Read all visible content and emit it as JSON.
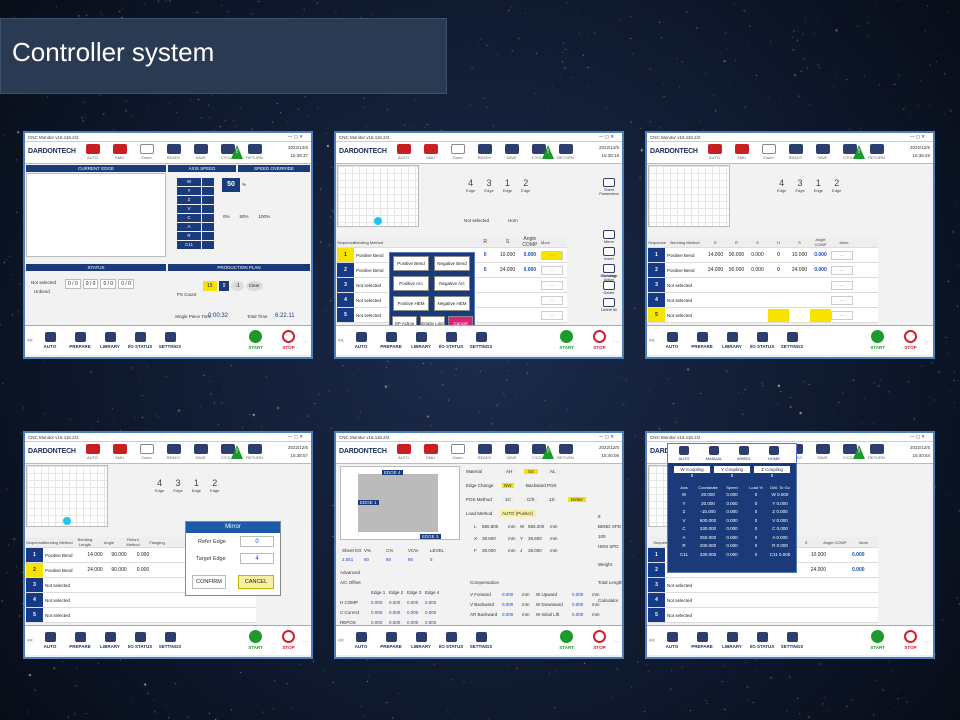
{
  "page": {
    "title": "Controller system"
  },
  "common": {
    "app_title": "CNC Monitor v16.116.2/2",
    "logo": "DARDONTECH",
    "toolbar": [
      "AUTO",
      "SMU",
      "Zoom",
      "READY",
      "SAVE",
      "CYCLE",
      "RETURN"
    ],
    "date": "2022/12/5",
    "bottom": [
      "AUTO",
      "PREPARE",
      "LIBRARY",
      "I/O STATUS",
      "SETTINGS"
    ],
    "start": "START",
    "stop": "STOP",
    "prev": "<<",
    "more": "...",
    "colors": {
      "navy": "#1a3a7a",
      "accent": "#23c5e6",
      "yellow": "#f6e300",
      "green": "#1d9a2c",
      "red": "#d02030"
    }
  },
  "screens": [
    {
      "time": "15:38:37",
      "current_edge": "CURRENT EDGE",
      "axis_speed": "AXIS SPEED",
      "speed_override": "SPEED OVERRIDE",
      "axes": [
        "W",
        "Y",
        "Z",
        "V",
        "C",
        "A",
        "R",
        "C11"
      ],
      "override_value": "50",
      "override_unit": "%",
      "pct_labels": [
        "0%",
        "50%",
        "100%"
      ],
      "status": "STATUS",
      "production_plan": "PRODUCTION PLAN",
      "not_selected": "Not selected",
      "unbend": "Unbend",
      "counters": [
        "0 / 0",
        "0 / 0",
        "0 / 0",
        "0 / 0"
      ],
      "ps_count": "PS Count",
      "plan_values": [
        "15",
        "9",
        "-1",
        "Clear"
      ],
      "single_piece_time_label": "Single Piece Time",
      "single_piece_time": "0:00:32",
      "total_time_label": "Total Time",
      "total_time": "6:22.11"
    },
    {
      "time": "15:38:18",
      "edges": [
        "4",
        "3",
        "1",
        "2"
      ],
      "edge_label": "Edge",
      "not_selected": "Not selected",
      "horn": "Horn",
      "sheet_params": "Sheet Parameters",
      "columns": [
        "Sequence",
        "Bending Method",
        "R",
        "S",
        "Angle COMP",
        "More"
      ],
      "rows": [
        {
          "n": "1",
          "m": "Positive Bend",
          "r": "0",
          "s": "10.000",
          "a": "0.000"
        },
        {
          "n": "2",
          "m": "Positive Bend",
          "r": "0",
          "s": "24.000",
          "a": "0.000"
        },
        {
          "n": "3",
          "m": "Not selected"
        },
        {
          "n": "4",
          "m": "Not selected"
        },
        {
          "n": "5",
          "m": "Not selected"
        }
      ],
      "menu": [
        "Positive Bend",
        "Negative Bend",
        "Positive Arc",
        "Negative Arc",
        "Positive HEM",
        "Negative HEM",
        "SP Action",
        "Empty Line",
        "Cancel"
      ],
      "side": [
        "Mirror",
        "Insert",
        "Exchange",
        "Delete",
        "Delete All"
      ],
      "bending_action": "Bending Action"
    },
    {
      "time": "15:38:49",
      "edges": [
        "4",
        "3",
        "1",
        "2"
      ],
      "columns": [
        "Sequence",
        "Bending Method",
        "E",
        "R",
        "S",
        "H",
        "S",
        "Angle COMP",
        "More"
      ],
      "rows": [
        {
          "n": "1",
          "m": "Positive Bend",
          "e": "14.000",
          "r": "90.000",
          "s": "0.000",
          "h": "0",
          "s2": "10.000",
          "a": "0.000"
        },
        {
          "n": "2",
          "m": "Positive Bend",
          "e": "24.000",
          "r": "90.000",
          "s": "0.000",
          "h": "0",
          "s2": "24.000",
          "a": "0.000"
        },
        {
          "n": "3",
          "m": "Not selected"
        },
        {
          "n": "4",
          "m": "Not selected"
        },
        {
          "n": "5",
          "m": "Not selected"
        }
      ]
    },
    {
      "time": "15:38:57",
      "columns": [
        "Sequence",
        "Bending Method",
        "Bending Length",
        "Angle",
        "Return Method",
        "Flanging"
      ],
      "rows": [
        {
          "n": "1",
          "m": "Positive Bend",
          "l": "14.000",
          "a": "90.000",
          "r": "0.000"
        },
        {
          "n": "2",
          "m": "Positive Bend",
          "l": "24.000",
          "a": "90.000",
          "r": "0.000"
        },
        {
          "n": "3",
          "m": "Not selected"
        },
        {
          "n": "4",
          "m": "Not selected"
        },
        {
          "n": "5",
          "m": "Not selected"
        }
      ],
      "mirror_title": "Mirror",
      "refer_edge_label": "Refer Edge",
      "refer_edge": "0",
      "target_edge_label": "Target Edge",
      "target_edge": "4",
      "confirm": "CONFIRM",
      "cancel": "CANCEL"
    },
    {
      "time": "15:40:08",
      "edge_tags": [
        "EDGE 4",
        "EDGE 1",
        "EDGE 3"
      ],
      "material": "Material",
      "material_opts": [
        "AH",
        "SS",
        "AL"
      ],
      "edge_change": "Edge Change",
      "edge_change_opts": [
        "NW",
        "Backward Print"
      ],
      "pos_method": "POS Method",
      "pos_opts": [
        "1C",
        "C/S",
        "1S",
        "Better"
      ],
      "load_method": "Load Method",
      "load_value": "AUTO (Pusher)",
      "dims": [
        {
          "k": "L",
          "v": "580.800",
          "k2": "W",
          "v2": "555.200"
        },
        {
          "k": "X",
          "v": "38.600",
          "k2": "Y",
          "v2": "38.600"
        },
        {
          "k": "F",
          "v": "38.000",
          "k2": "J",
          "v2": "38.000"
        }
      ],
      "mm": "mm",
      "sheet_hdr": [
        "Sheet KG",
        "V%",
        "C%",
        "VC%",
        "LEVEL"
      ],
      "sheet_vals": [
        "2.551",
        "80",
        "80",
        "80",
        "5"
      ],
      "advanced": "Advanced",
      "compensation": "Compensation",
      "avc_offset": "A/C Offset",
      "edge_cols": [
        "Edge 1",
        "Edge 2",
        "Edge 3",
        "Edge 4"
      ],
      "adv_rows": [
        "H COMP",
        "C Correct",
        "REPOS"
      ],
      "comp_rows": [
        "V Forward",
        "V Backward",
        "AR Backward"
      ],
      "comp_rows2": [
        "W Upward",
        "W Downward",
        "W Initial Lift"
      ],
      "right": [
        "9",
        "BEND SPD",
        "100",
        "HEM SPD",
        "Weight",
        "Total Length",
        "Calculator"
      ]
    },
    {
      "time": "15:40:54",
      "modes": [
        "AUTO",
        "MANUAL",
        "WHEEL",
        "HOME"
      ],
      "couplings": [
        "W Coupling",
        "Y Coupling",
        "Z Coupling"
      ],
      "coupling_vals": [
        "0",
        "0",
        "0"
      ],
      "cols": [
        "Axis",
        "Coordinate",
        "Speed",
        "Load %",
        "Drill. To Go"
      ],
      "axis_rows": [
        {
          "a": "W",
          "c": "20.000",
          "s": "0.000",
          "l": "0",
          "g": "0.000"
        },
        {
          "a": "Y",
          "c": "20.000",
          "s": "0.000",
          "l": "0",
          "g": "0.000"
        },
        {
          "a": "Z",
          "c": "-15.000",
          "s": "0.000",
          "l": "0",
          "g": "0.000"
        },
        {
          "a": "V",
          "c": "600.000",
          "s": "0.000",
          "l": "0",
          "g": "0.000"
        },
        {
          "a": "C",
          "c": "330.000",
          "s": "0.000",
          "l": "0",
          "g": "0.000"
        },
        {
          "a": "A",
          "c": "250.000",
          "s": "0.000",
          "l": "0",
          "g": "0.000"
        },
        {
          "a": "R",
          "c": "200.000",
          "s": "0.000",
          "l": "0",
          "g": "0.000"
        },
        {
          "a": "C11",
          "c": "330.000",
          "s": "0.000",
          "l": "0",
          "g": "0.000"
        }
      ]
    }
  ]
}
